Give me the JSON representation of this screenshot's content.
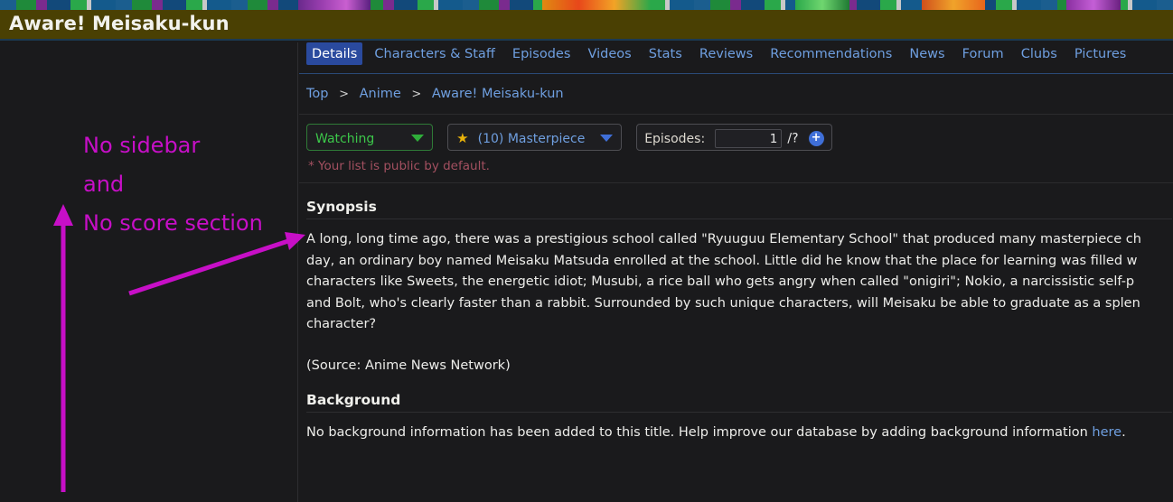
{
  "header": {
    "title": "Aware! Meisaku-kun",
    "banner_color": "#4a4003"
  },
  "tabs": [
    {
      "label": "Details",
      "active": true
    },
    {
      "label": "Characters & Staff",
      "active": false
    },
    {
      "label": "Episodes",
      "active": false
    },
    {
      "label": "Videos",
      "active": false
    },
    {
      "label": "Stats",
      "active": false
    },
    {
      "label": "Reviews",
      "active": false
    },
    {
      "label": "Recommendations",
      "active": false
    },
    {
      "label": "News",
      "active": false
    },
    {
      "label": "Forum",
      "active": false
    },
    {
      "label": "Clubs",
      "active": false
    },
    {
      "label": "Pictures",
      "active": false
    }
  ],
  "breadcrumb": {
    "items": [
      "Top",
      "Anime",
      "Aware! Meisaku-kun"
    ],
    "separator": ">"
  },
  "list_controls": {
    "status": {
      "value": "Watching",
      "caret_icon": "chevron-down-icon",
      "accent": "#3cc74a"
    },
    "score": {
      "star_icon": "★",
      "value": "(10) Masterpiece",
      "caret_icon": "chevron-down-icon",
      "accent": "#6f9fe0"
    },
    "episodes": {
      "label": "Episodes:",
      "watched": "1",
      "total": "/?",
      "increment_icon": "+"
    },
    "public_note": "* Your list is public by default."
  },
  "synopsis": {
    "heading": "Synopsis",
    "line1": "A long, long time ago, there was a prestigious school called \"Ryuuguu Elementary School\" that produced many masterpiece ch",
    "line2": "day, an ordinary boy named Meisaku Matsuda enrolled at the school. Little did he know that the place for learning was filled w",
    "line3": "characters like Sweets, the energetic idiot; Musubi, a rice ball who gets angry when called \"onigiri\"; Nokio, a narcissistic self-p",
    "line4": "and Bolt, who's clearly faster than a rabbit. Surrounded by such unique characters, will Meisaku be able to graduate as a splen",
    "line5": "character?",
    "source": "(Source: Anime News Network)"
  },
  "background": {
    "heading": "Background",
    "text_before": "No background information has been added to this title. Help improve our database by adding background information ",
    "link": "here",
    "text_after": "."
  },
  "annotation": {
    "line1": "No sidebar",
    "line2": "and",
    "line3": "No score section",
    "color": "#c70fc7"
  }
}
